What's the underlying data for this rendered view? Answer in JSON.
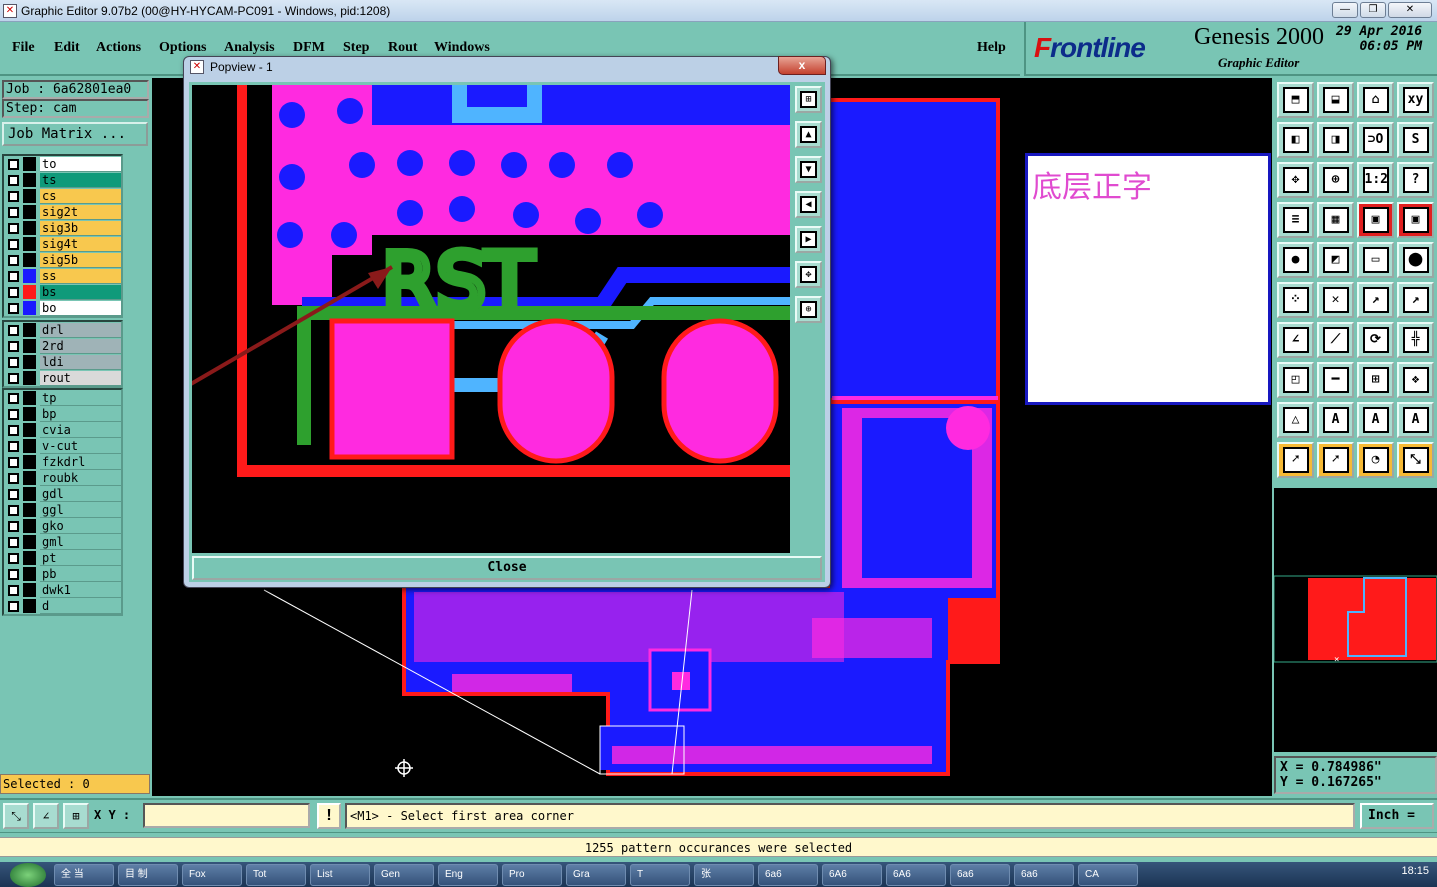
{
  "window": {
    "title": "Graphic Editor 9.07b2 (00@HY-HYCAM-PC091 - Windows, pid:1208)",
    "controls": {
      "minimize": "—",
      "restore": "❐",
      "close": "✕"
    }
  },
  "menu": {
    "items": [
      "File",
      "Edit",
      "Actions",
      "Options",
      "Analysis",
      "DFM",
      "Step",
      "Rout",
      "Windows"
    ],
    "help": "Help"
  },
  "logo": {
    "brand_f": "F",
    "brand_rest": "rontline",
    "product": "Genesis 2000",
    "subtitle": "Graphic Editor",
    "date": "29 Apr 2016",
    "time": "06:05 PM"
  },
  "left_panel": {
    "job": "Job : 6a62801ea0",
    "step": "Step: cam",
    "job_matrix": "Job Matrix ...",
    "selected": "Selected : 0",
    "groups": [
      [
        {
          "name": "to",
          "bg": "#ffffff",
          "swatch": "#000000"
        },
        {
          "name": "ts",
          "bg": "#0f9a7a",
          "swatch": "#000000"
        },
        {
          "name": "cs",
          "bg": "#f8c84e",
          "swatch": "#000000"
        },
        {
          "name": "sig2t",
          "bg": "#f8c84e",
          "swatch": "#000000"
        },
        {
          "name": "sig3b",
          "bg": "#f8c84e",
          "swatch": "#000000"
        },
        {
          "name": "sig4t",
          "bg": "#f8c84e",
          "swatch": "#000000"
        },
        {
          "name": "sig5b",
          "bg": "#f8c84e",
          "swatch": "#000000"
        },
        {
          "name": "ss",
          "bg": "#f8c84e",
          "swatch": "#1a1aff"
        },
        {
          "name": "bs",
          "bg": "#0f9a7a",
          "swatch": "#ff1a1a"
        },
        {
          "name": "bo",
          "bg": "#ffffff",
          "swatch": "#1a1aff"
        }
      ],
      [
        {
          "name": "drl",
          "bg": "#9fb3b7",
          "swatch": "#000000"
        },
        {
          "name": "2rd",
          "bg": "#9fb3b7",
          "swatch": "#000000"
        },
        {
          "name": "ldi",
          "bg": "#9fb3b7",
          "swatch": "#000000"
        },
        {
          "name": "rout",
          "bg": "#d9d9d9",
          "swatch": "#000000"
        }
      ],
      [
        {
          "name": "tp",
          "bg": "#79c5b4",
          "swatch": "#000000"
        },
        {
          "name": "bp",
          "bg": "#79c5b4",
          "swatch": "#000000"
        },
        {
          "name": "cvia",
          "bg": "#79c5b4",
          "swatch": "#000000"
        },
        {
          "name": "v-cut",
          "bg": "#79c5b4",
          "swatch": "#000000"
        },
        {
          "name": "fzkdrl",
          "bg": "#79c5b4",
          "swatch": "#000000"
        },
        {
          "name": "roubk",
          "bg": "#79c5b4",
          "swatch": "#000000"
        },
        {
          "name": "gdl",
          "bg": "#79c5b4",
          "swatch": "#000000"
        },
        {
          "name": "ggl",
          "bg": "#79c5b4",
          "swatch": "#000000"
        },
        {
          "name": "gko",
          "bg": "#79c5b4",
          "swatch": "#000000"
        },
        {
          "name": "gml",
          "bg": "#79c5b4",
          "swatch": "#000000"
        },
        {
          "name": "pt",
          "bg": "#79c5b4",
          "swatch": "#000000"
        },
        {
          "name": "pb",
          "bg": "#79c5b4",
          "swatch": "#000000"
        },
        {
          "name": "dwk1",
          "bg": "#79c5b4",
          "swatch": "#000000"
        },
        {
          "name": "d",
          "bg": "#79c5b4",
          "swatch": "#000000"
        }
      ]
    ]
  },
  "popview": {
    "title": "Popview - 1",
    "close_x": "x",
    "close_label": "Close",
    "silk_text": "RST"
  },
  "canvas": {
    "note": "底层正字",
    "colors": {
      "board": "#1a1aff",
      "copper": "#ff2ae0",
      "outline": "#ff1a1a",
      "silk": "#2ea02e",
      "trace": "#4fb4ff"
    }
  },
  "tools": {
    "rows": [
      [
        {
          "glyph": "⬒",
          "style": "normal"
        },
        {
          "glyph": "⬓",
          "style": "normal"
        },
        {
          "glyph": "⌂",
          "style": "normal"
        },
        {
          "glyph": "xy",
          "style": "normal"
        }
      ],
      [
        {
          "glyph": "◧",
          "style": "normal"
        },
        {
          "glyph": "◨",
          "style": "normal"
        },
        {
          "glyph": "⊃O",
          "style": "normal"
        },
        {
          "glyph": "S",
          "style": "normal"
        }
      ],
      [
        {
          "glyph": "✥",
          "style": "normal"
        },
        {
          "glyph": "⊕",
          "style": "normal"
        },
        {
          "glyph": "1:2",
          "style": "normal"
        },
        {
          "glyph": "?",
          "style": "normal"
        }
      ],
      [
        {
          "glyph": "≡",
          "style": "normal"
        },
        {
          "glyph": "▦",
          "style": "normal"
        },
        {
          "glyph": "▣",
          "style": "red"
        },
        {
          "glyph": "▣",
          "style": "red"
        }
      ],
      [
        {
          "glyph": "●",
          "style": "normal"
        },
        {
          "glyph": "◩",
          "style": "normal"
        },
        {
          "glyph": "▭",
          "style": "normal"
        },
        {
          "glyph": "⬤",
          "style": "normal"
        }
      ],
      [
        {
          "glyph": "⁘",
          "style": "normal"
        },
        {
          "glyph": "✕",
          "style": "normal"
        },
        {
          "glyph": "↗",
          "style": "normal"
        },
        {
          "glyph": "↗",
          "style": "normal"
        }
      ],
      [
        {
          "glyph": "∠",
          "style": "normal"
        },
        {
          "glyph": "⟋",
          "style": "normal"
        },
        {
          "glyph": "⟳",
          "style": "normal"
        },
        {
          "glyph": "╬",
          "style": "normal"
        }
      ],
      [
        {
          "glyph": "◰",
          "style": "normal"
        },
        {
          "glyph": "━",
          "style": "normal"
        },
        {
          "glyph": "⊞",
          "style": "normal"
        },
        {
          "glyph": "❖",
          "style": "normal"
        }
      ],
      [
        {
          "glyph": "△",
          "style": "normal"
        },
        {
          "glyph": "A",
          "style": "normal"
        },
        {
          "glyph": "A",
          "style": "normal"
        },
        {
          "glyph": "A",
          "style": "normal"
        }
      ],
      [
        {
          "glyph": "➚",
          "style": "yel"
        },
        {
          "glyph": "➚",
          "style": "yel"
        },
        {
          "glyph": "◔",
          "style": "yel"
        },
        {
          "glyph": "⤡",
          "style": "yel"
        }
      ]
    ]
  },
  "coords": {
    "x": "X = 0.784986\"",
    "y": "Y = 0.167265\""
  },
  "statusbar": {
    "xy_label": "X Y :",
    "xy_value": "",
    "warn": "!",
    "prompt": "<M1> - Select first area corner",
    "unit": "Inch ="
  },
  "message": "1255 pattern occurances were selected",
  "taskbar": {
    "start": "",
    "items": [
      "全 当",
      "目 制",
      "Fox",
      "Tot",
      "List",
      "Gen",
      "Eng",
      "Pro",
      "Gra",
      "T",
      "张",
      "6a6",
      "6A6",
      "6A6",
      "6a6",
      "6a6",
      "CA"
    ],
    "clock": "18:15"
  }
}
